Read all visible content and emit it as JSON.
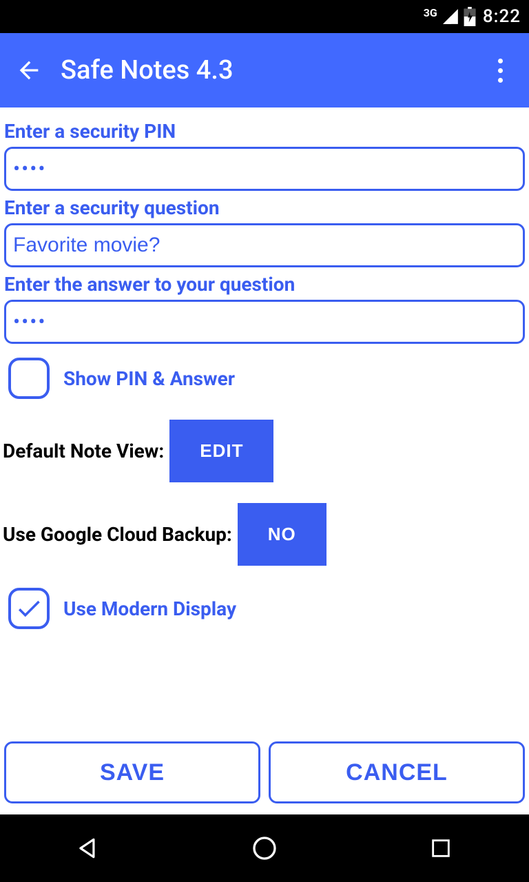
{
  "status": {
    "network": "3G",
    "time": "8:22"
  },
  "appbar": {
    "title": "Safe Notes 4.3"
  },
  "form": {
    "pin_label": "Enter a security PIN",
    "pin_value": "••••",
    "question_label": "Enter a security question",
    "question_value": "Favorite movie?",
    "answer_label": "Enter the answer to your question",
    "answer_value": "••••",
    "show_label": "Show PIN & Answer",
    "default_view_label": "Default Note View:",
    "default_view_btn": "EDIT",
    "cloud_label": "Use Google Cloud Backup:",
    "cloud_btn": "NO",
    "modern_label": "Use Modern Display",
    "save": "SAVE",
    "cancel": "CANCEL"
  }
}
